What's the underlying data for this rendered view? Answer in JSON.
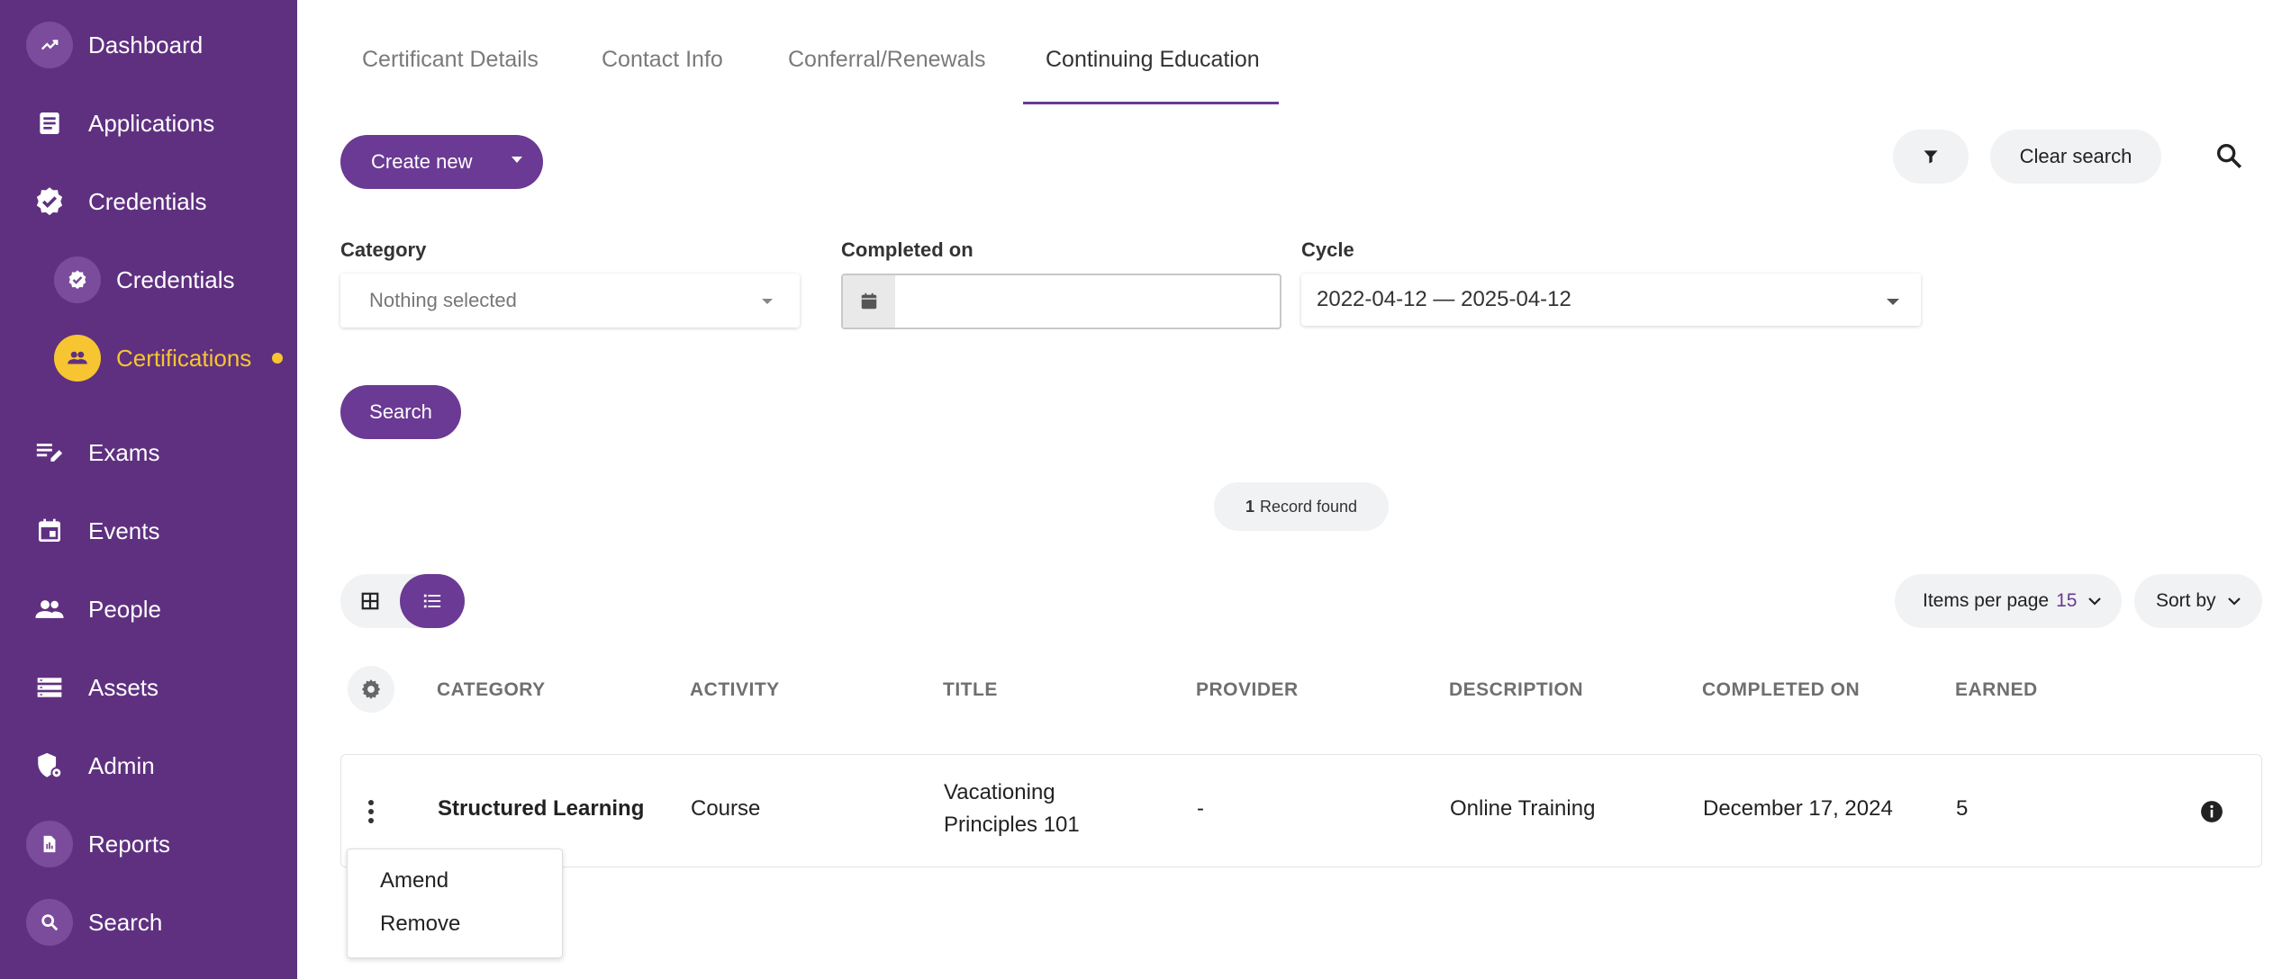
{
  "sidebar": {
    "items": [
      {
        "label": "Dashboard",
        "icon": "trend-icon"
      },
      {
        "label": "Applications",
        "icon": "document-icon"
      },
      {
        "label": "Credentials",
        "icon": "badge-check-icon"
      },
      {
        "label": "Credentials",
        "icon": "badge-check-icon"
      },
      {
        "label": "Certifications",
        "icon": "people-icon"
      },
      {
        "label": "Exams",
        "icon": "edit-list-icon"
      },
      {
        "label": "Events",
        "icon": "calendar-icon"
      },
      {
        "label": "People",
        "icon": "people-icon"
      },
      {
        "label": "Assets",
        "icon": "storage-icon"
      },
      {
        "label": "Admin",
        "icon": "admin-shield-icon"
      },
      {
        "label": "Reports",
        "icon": "report-icon"
      },
      {
        "label": "Search",
        "icon": "search-icon"
      }
    ],
    "colors": {
      "background": "#5f3080",
      "active": "#f7c531"
    }
  },
  "tabs": [
    {
      "label": "Certificant Details"
    },
    {
      "label": "Contact Info"
    },
    {
      "label": "Conferral/Renewals"
    },
    {
      "label": "Continuing Education"
    }
  ],
  "toolbar": {
    "create_label": "Create new",
    "clear_label": "Clear search"
  },
  "filters": {
    "category_label": "Category",
    "category_placeholder": "Nothing selected",
    "completed_label": "Completed on",
    "completed_value": "",
    "cycle_label": "Cycle",
    "cycle_value": "2022-04-12 — 2025-04-12",
    "search_label": "Search"
  },
  "records": {
    "count": "1",
    "text": "Record found"
  },
  "pagination": {
    "items_label": "Items per page",
    "items_value": "15",
    "sort_label": "Sort by"
  },
  "table": {
    "headers": [
      "CATEGORY",
      "ACTIVITY",
      "TITLE",
      "PROVIDER",
      "DESCRIPTION",
      "COMPLETED ON",
      "EARNED"
    ],
    "rows": [
      {
        "category": "Structured Learning",
        "activity": "Course",
        "title_line1": "Vacationing",
        "title_line2": "Principles 101",
        "provider": "-",
        "description": "Online Training",
        "completed_on": "December 17, 2024",
        "earned": "5"
      }
    ]
  },
  "context_menu": {
    "items": [
      "Amend",
      "Remove"
    ]
  },
  "accent_color": "#6b3a94"
}
